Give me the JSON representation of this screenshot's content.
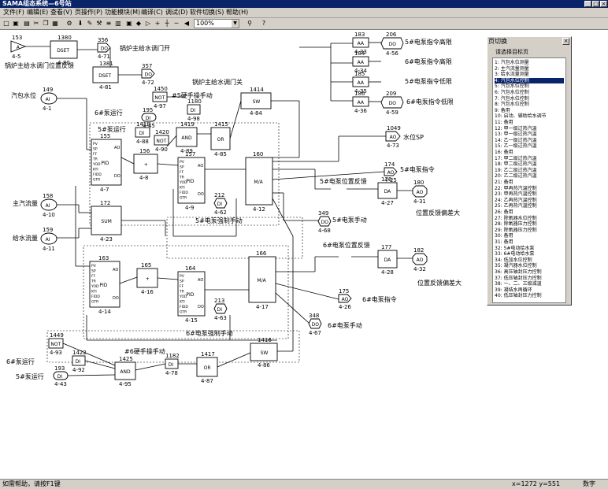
{
  "window": {
    "title": "SAMA组态系统—6号站"
  },
  "menu": [
    {
      "label": "文件(F)"
    },
    {
      "label": "编辑(E)"
    },
    {
      "label": "查看(V)"
    },
    {
      "label": "页操作(P)"
    },
    {
      "label": "功能模块(M)"
    },
    {
      "label": "编译(C)"
    },
    {
      "label": "调试(D)"
    },
    {
      "label": "软件切换(S)"
    },
    {
      "label": "帮助(H)"
    }
  ],
  "toolbar": {
    "zoom_value": "100%"
  },
  "status": {
    "help": "如需帮助，请按F1键",
    "coords": "x=1272   y=551",
    "mode": "数字"
  },
  "panel": {
    "title": "页切换",
    "prompt": "请选择目标页",
    "selected_index": 3,
    "items": [
      "1:  汽包水位测量",
      "2:  主汽流量测量",
      "3:  给水流量测量",
      "4:  汽包水位控制",
      "5:  汽包水位控制",
      "6:  汽包水位控制",
      "7:  汽包水位控制",
      "8:  汽包水位控制",
      "9:  备用",
      "10: 启动、辅助给水调节",
      "11: 备用",
      "12: 甲一级过热汽温",
      "13: 甲一级过热汽温",
      "14: 乙一级过热汽温",
      "15: 乙一级过热汽温",
      "16: 备用",
      "17: 甲二级过热汽温",
      "18: 甲二级过热汽温",
      "19: 乙二级过热汽温",
      "20: 乙二级过热汽温",
      "21: 备用",
      "22: 甲再热汽温控制",
      "23: 甲再热汽温控制",
      "24: 乙再热汽温控制",
      "25: 乙再热汽温控制",
      "26: 备用",
      "27: 除氧器水位控制",
      "28: 除氧器压力控制",
      "29: 除氧器压力控制",
      "30: 备用",
      "31: 备用",
      "32: 5#电动给水泵",
      "33: 6#电动给水泵",
      "34: 低加水位控制",
      "35: 凝汽器水位控制",
      "36: 高压轴封压力控制",
      "37: 低压轴封压力控制",
      "38: 一、二、三级减温",
      "39: 凝结水再循环",
      "40: 低压轴封压力控制"
    ]
  },
  "diagram": {
    "blocks": [
      {
        "id": "b153",
        "num": "153",
        "code": "4-5",
        "body": "A"
      },
      {
        "id": "b1380",
        "num": "1380",
        "code": "4-80",
        "body": "DSET"
      },
      {
        "id": "b356",
        "num": "356",
        "code": "4-71",
        "body": "DO"
      },
      {
        "id": "b1381",
        "num": "1381",
        "code": "4-81",
        "body": "DSET"
      },
      {
        "id": "b357",
        "num": "357",
        "code": "4-72",
        "body": "DO"
      },
      {
        "id": "b149",
        "num": "149",
        "code": "4-1",
        "body": "AI"
      },
      {
        "id": "b1450",
        "num": "1450",
        "code": "4-97",
        "body": "NOT"
      },
      {
        "id": "b1180",
        "num": "1180",
        "code": "4-98",
        "body": "DI"
      },
      {
        "id": "b1414",
        "num": "1414",
        "code": "4-84",
        "body": "SW"
      },
      {
        "id": "b195",
        "num": "195",
        "code": "4-45",
        "body": "DI"
      },
      {
        "id": "b1418",
        "num": "1418",
        "code": "4-88",
        "body": "DI"
      },
      {
        "id": "b1420",
        "num": "1420",
        "code": "4-90",
        "body": "NOT"
      },
      {
        "id": "b1419",
        "num": "1419",
        "code": "4-89",
        "body": "AND"
      },
      {
        "id": "b1415",
        "num": "1415",
        "code": "4-85",
        "body": "OR"
      },
      {
        "id": "b155",
        "num": "155",
        "code": "4-7",
        "body": "PID"
      },
      {
        "id": "b156",
        "num": "156",
        "code": "4-8",
        "body": "+"
      },
      {
        "id": "b157",
        "num": "157",
        "code": "4-9",
        "body": "PID"
      },
      {
        "id": "b160",
        "num": "160",
        "code": "4-12",
        "body": "M/A"
      },
      {
        "id": "b212",
        "num": "212",
        "code": "4-62",
        "body": "DI"
      },
      {
        "id": "b158",
        "num": "158",
        "code": "4-10",
        "body": "AI"
      },
      {
        "id": "b172",
        "num": "172",
        "code": "4-23",
        "body": "SUM"
      },
      {
        "id": "b159",
        "num": "159",
        "code": "4-11",
        "body": "AI"
      },
      {
        "id": "b163",
        "num": "163",
        "code": "4-14",
        "body": "PID"
      },
      {
        "id": "b165",
        "num": "165",
        "code": "4-16",
        "body": "+"
      },
      {
        "id": "b164",
        "num": "164",
        "code": "4-15",
        "body": "PID"
      },
      {
        "id": "b166",
        "num": "166",
        "code": "4-17",
        "body": "M/A"
      },
      {
        "id": "b213",
        "num": "213",
        "code": "4-63",
        "body": "DI"
      },
      {
        "id": "b183",
        "num": "183",
        "code": "4-33",
        "body": "AA"
      },
      {
        "id": "b206",
        "num": "206",
        "code": "4-56",
        "body": "DO"
      },
      {
        "id": "b184",
        "num": "184",
        "code": "4-34",
        "body": "AA"
      },
      {
        "id": "b185",
        "num": "185",
        "code": "4-35",
        "body": "AA"
      },
      {
        "id": "b186",
        "num": "186",
        "code": "4-36",
        "body": "AA"
      },
      {
        "id": "b209",
        "num": "209",
        "code": "4-59",
        "body": "DO"
      },
      {
        "id": "b1049",
        "num": "1049",
        "code": "4-73",
        "body": "AO"
      },
      {
        "id": "b174",
        "num": "174",
        "code": "4-25",
        "body": "AO"
      },
      {
        "id": "b176",
        "num": "176",
        "code": "4-27",
        "body": "DA"
      },
      {
        "id": "b180",
        "num": "180",
        "code": "4-31",
        "body": "AO"
      },
      {
        "id": "b349",
        "num": "349",
        "code": "4-68",
        "body": "DO"
      },
      {
        "id": "b177",
        "num": "177",
        "code": "4-28",
        "body": "DA"
      },
      {
        "id": "b182",
        "num": "182",
        "code": "4-32",
        "body": "AO"
      },
      {
        "id": "b175",
        "num": "175",
        "code": "4-26",
        "body": "AO"
      },
      {
        "id": "b348",
        "num": "348",
        "code": "4-67",
        "body": "DO"
      },
      {
        "id": "b1449",
        "num": "1449",
        "code": "4-93",
        "body": "NOT"
      },
      {
        "id": "b1422",
        "num": "1422",
        "code": "4-92",
        "body": "DI"
      },
      {
        "id": "b193",
        "num": "193",
        "code": "4-43",
        "body": "DI"
      },
      {
        "id": "b1425",
        "num": "1425",
        "code": "4-95",
        "body": "AND"
      },
      {
        "id": "b1182",
        "num": "1182",
        "code": "4-78",
        "body": "DI"
      },
      {
        "id": "b1417",
        "num": "1417",
        "code": "4-87",
        "body": "OR"
      },
      {
        "id": "b1416",
        "num": "1416",
        "code": "4-86",
        "body": "SW"
      }
    ],
    "labels": [
      {
        "id": "lbl-open",
        "text": "锅炉主给水调门开"
      },
      {
        "id": "lbl-fb",
        "text": "锅炉主给水调门位置反馈"
      },
      {
        "id": "lbl-close",
        "text": "锅炉主给水调门关"
      },
      {
        "id": "lbl-drum",
        "text": "汽包水位"
      },
      {
        "id": "lbl-5man",
        "text": "#5硬手操手动"
      },
      {
        "id": "lbl-6run",
        "text": "6#泵运行"
      },
      {
        "id": "lbl-5run",
        "text": "5#泵运行"
      },
      {
        "id": "lbl-steam",
        "text": "主汽流量"
      },
      {
        "id": "lbl-water",
        "text": "给水流量"
      },
      {
        "id": "lbl-5force",
        "text": "5#电泵强制手动"
      },
      {
        "id": "lbl-5high",
        "text": "5#电泵指令高限"
      },
      {
        "id": "lbl-6high",
        "text": "6#电泵指令高限"
      },
      {
        "id": "lbl-5low",
        "text": "5#电泵指令低限"
      },
      {
        "id": "lbl-6low",
        "text": "6#电泵指令低限"
      },
      {
        "id": "lbl-sp",
        "text": "水位SP"
      },
      {
        "id": "lbl-5cmd",
        "text": "5#电泵指令"
      },
      {
        "id": "lbl-5pos",
        "text": "5#电泵位置反馈"
      },
      {
        "id": "lbl-dev1",
        "text": "位置反馈偏差大"
      },
      {
        "id": "lbl-5hand",
        "text": "5#电泵手动"
      },
      {
        "id": "lbl-6pos",
        "text": "6#电泵位置反馈"
      },
      {
        "id": "lbl-dev2",
        "text": "位置反馈偏差大"
      },
      {
        "id": "lbl-6cmd",
        "text": "6#电泵指令"
      },
      {
        "id": "lbl-6hand",
        "text": "6#电泵手动"
      },
      {
        "id": "lbl-6force",
        "text": "6#电泵强制手动"
      },
      {
        "id": "lbl-6man",
        "text": "#6硬手操手动"
      },
      {
        "id": "lbl-6run2",
        "text": "6#泵运行"
      },
      {
        "id": "lbl-5run2",
        "text": "5#泵运行"
      }
    ]
  }
}
